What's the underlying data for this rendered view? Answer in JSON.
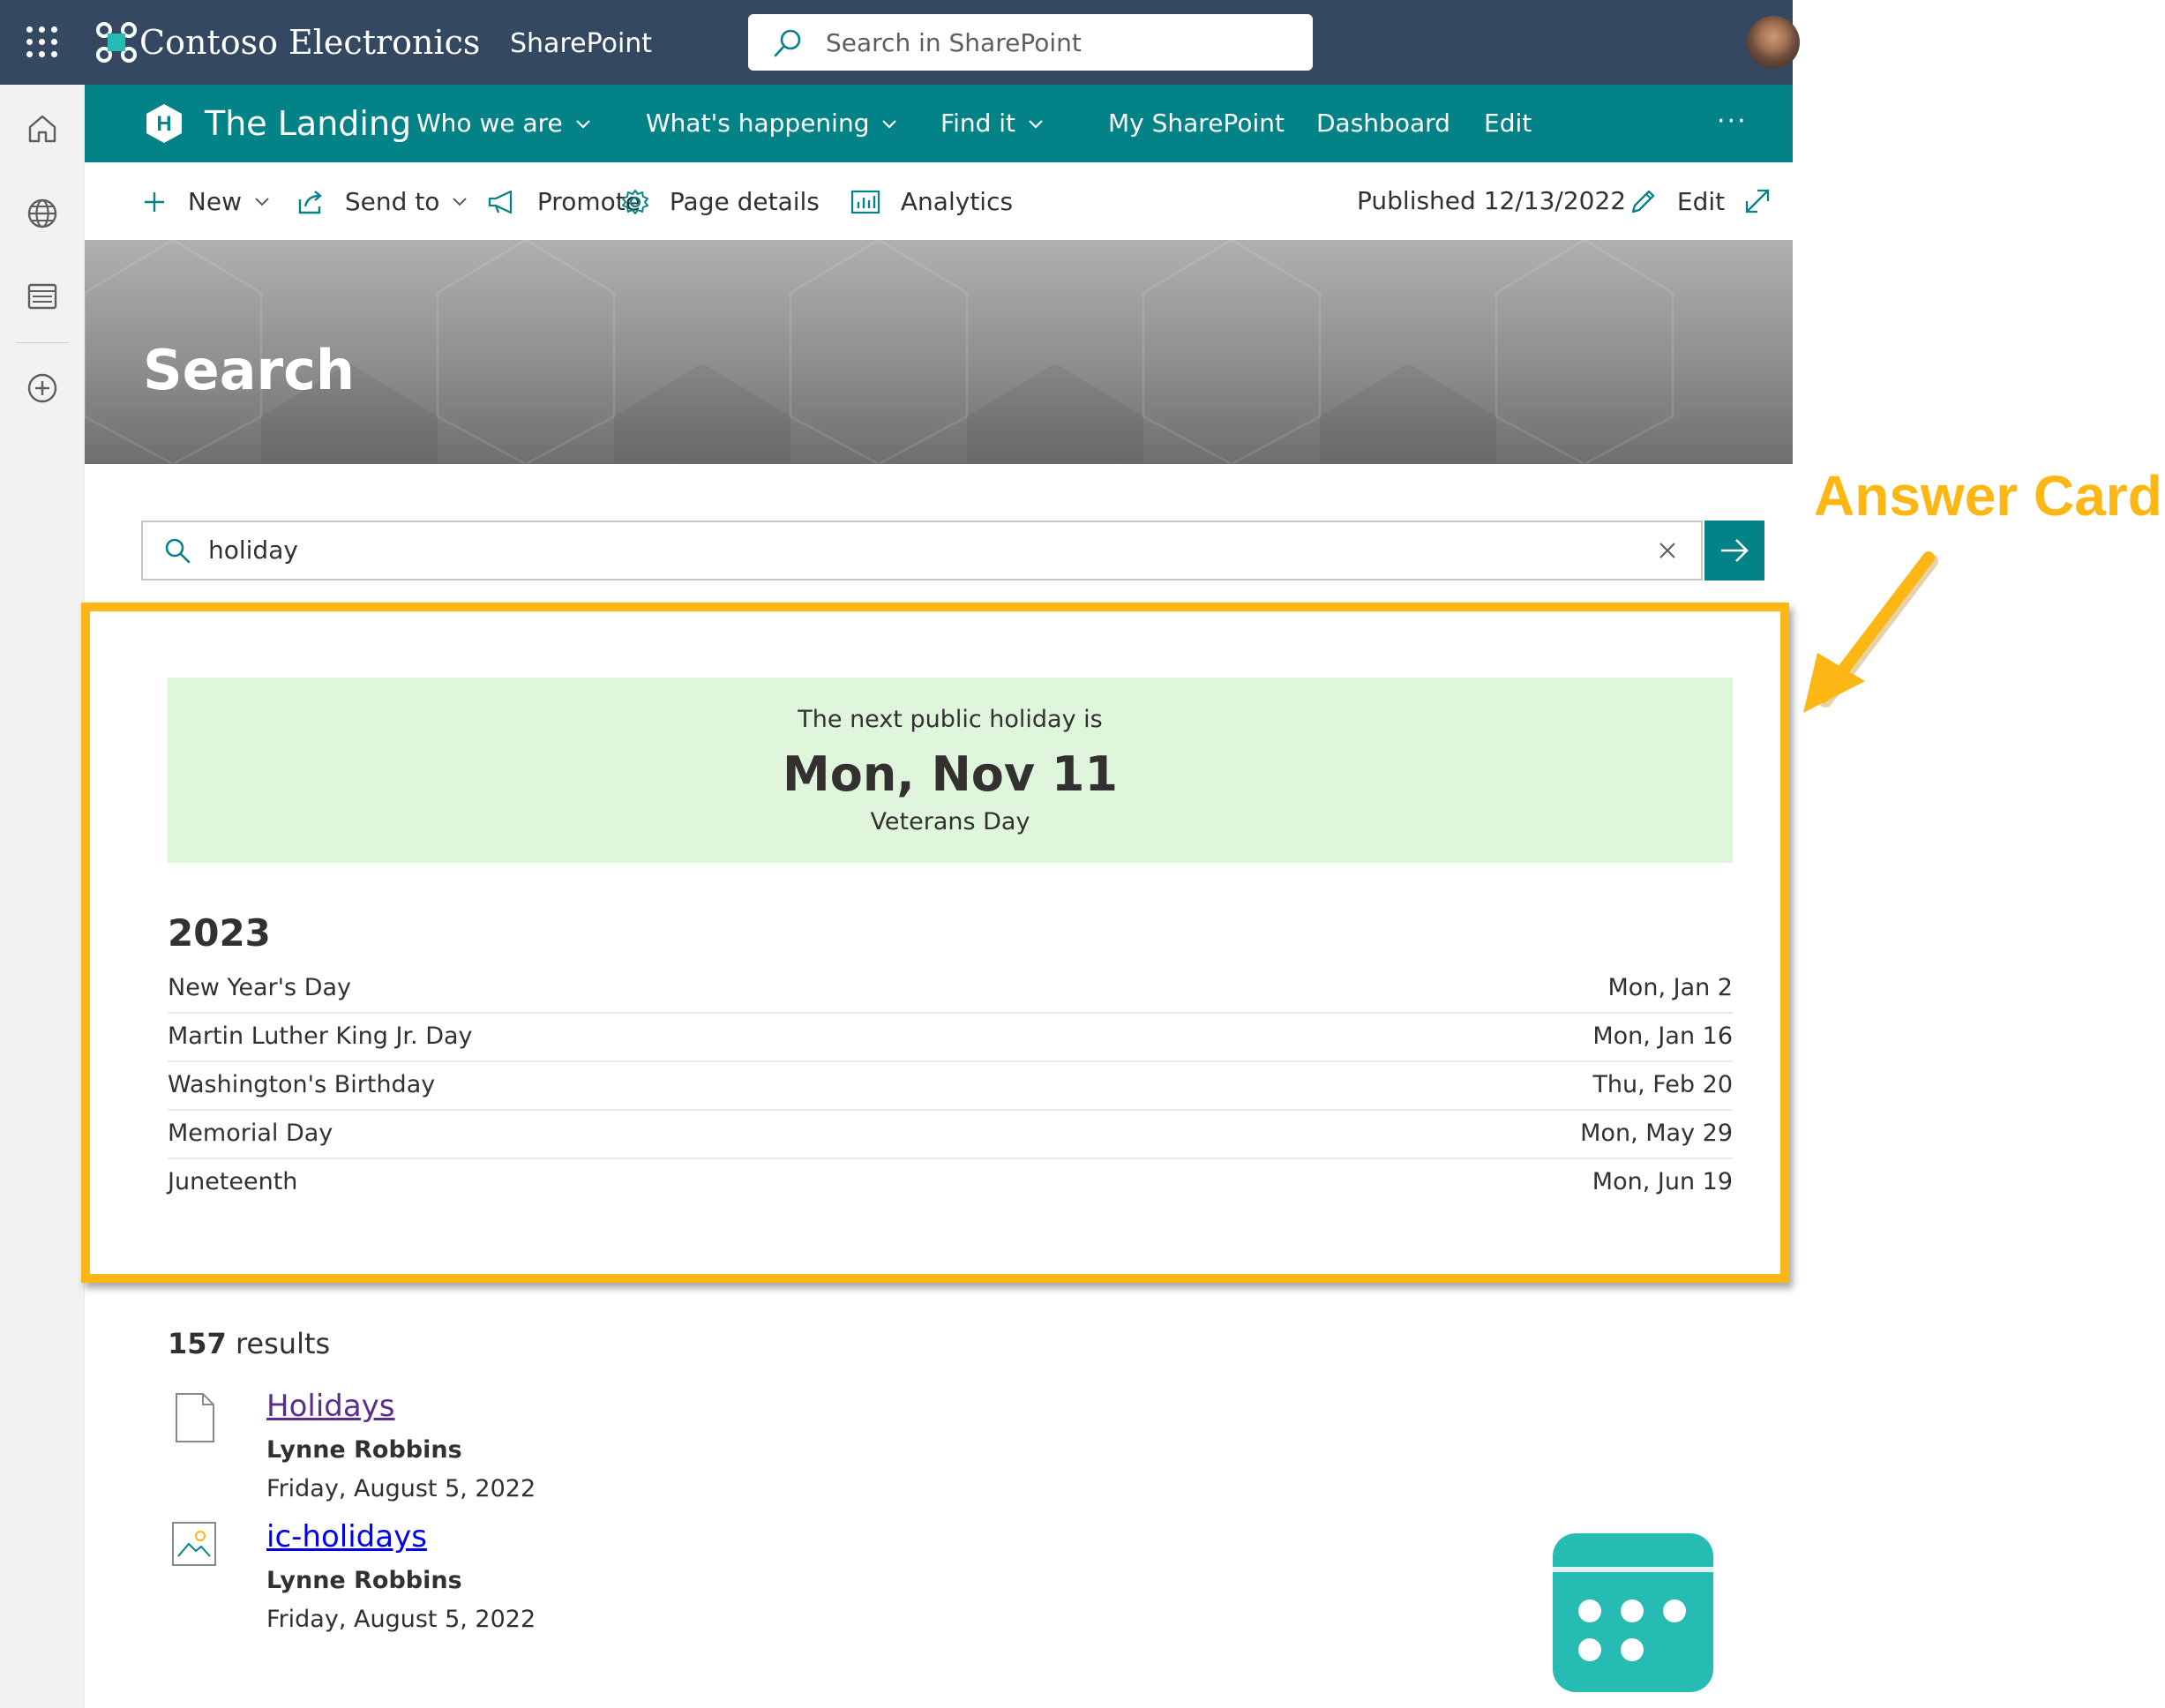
{
  "suite": {
    "brand": "Contoso Electronics",
    "app": "SharePoint",
    "search_placeholder": "Search in SharePoint"
  },
  "hub": {
    "logo_letter": "H",
    "title": "The Landing",
    "items": [
      {
        "label": "Who we are",
        "has_menu": true
      },
      {
        "label": "What's happening",
        "has_menu": true
      },
      {
        "label": "Find it",
        "has_menu": true
      },
      {
        "label": "My SharePoint",
        "has_menu": false
      },
      {
        "label": "Dashboard",
        "has_menu": false
      },
      {
        "label": "Edit",
        "has_menu": false
      }
    ],
    "more": "···"
  },
  "commands": {
    "new": "New",
    "send_to": "Send to",
    "promote": "Promote",
    "page_details": "Page details",
    "analytics": "Analytics",
    "published": "Published 12/13/2022",
    "edit": "Edit"
  },
  "page": {
    "title": "Search"
  },
  "search": {
    "query": "holiday"
  },
  "answer_card": {
    "intro": "The next public holiday is",
    "next_date": "Mon, Nov 11",
    "next_name": "Veterans Day",
    "year": "2023",
    "holidays": [
      {
        "name": "New Year's Day",
        "date": "Mon, Jan 2"
      },
      {
        "name": "Martin Luther King Jr. Day",
        "date": "Mon, Jan 16"
      },
      {
        "name": "Washington's Birthday",
        "date": "Thu, Feb 20"
      },
      {
        "name": "Memorial Day",
        "date": "Mon, May 29"
      },
      {
        "name": "Juneteenth",
        "date": "Mon, Jun 19"
      }
    ]
  },
  "annotation": {
    "label": "Answer Card",
    "color": "#fcb714"
  },
  "results": {
    "count": "157",
    "count_suffix": "results",
    "items": [
      {
        "title": "Holidays",
        "author": "Lynne Robbins",
        "date": "Friday, August 5, 2022",
        "icon": "document-icon",
        "visited": true
      },
      {
        "title": "ic-holidays",
        "author": "Lynne Robbins",
        "date": "Friday, August 5, 2022",
        "icon": "image-file-icon",
        "visited": false
      }
    ]
  },
  "colors": {
    "suite_bar": "#344961",
    "theme": "#038387",
    "answer_bg": "#dff6dd",
    "visited_link": "#5c2d91",
    "link": "#0000ee",
    "calendar": "#26bbb3"
  }
}
